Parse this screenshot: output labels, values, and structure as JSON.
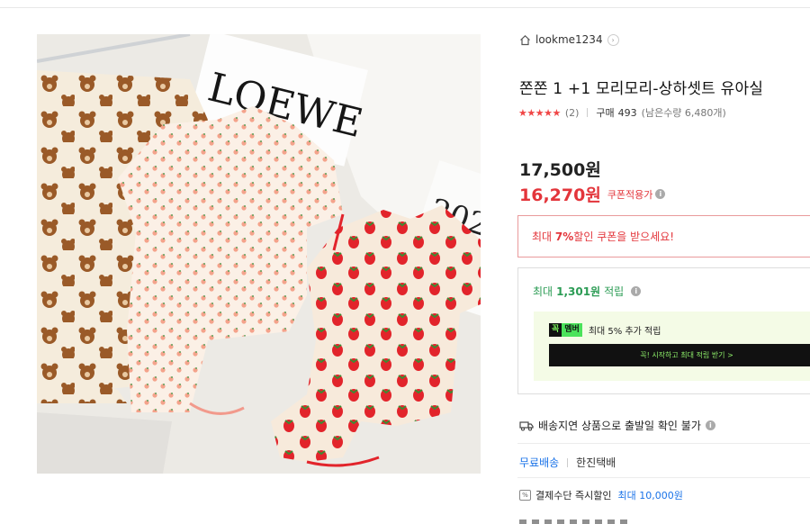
{
  "seller": {
    "name": "lookme1234",
    "home_icon": "home-icon",
    "chevron_icon": "chevron-right-icon"
  },
  "product": {
    "title": "쫀쫀 1 +1 모리모리-상하셋트 유아실",
    "rating_stars": "★★★★★",
    "review_count": "(2)",
    "purchase_label": "구매",
    "purchase_count": "493",
    "stock_text": "(남은수량 6,480개)",
    "price_original": "17,500원",
    "price_sale": "16,270원",
    "coupon_applied_label": "쿠폰적용가"
  },
  "coupon_banner": {
    "prefix": "최대 ",
    "percent": "7%",
    "suffix": " 할인 쿠폰을 받으세요!"
  },
  "points": {
    "prefix": "최대 ",
    "amount": "1,301원",
    "suffix": " 적립",
    "member": {
      "badge_left": "꼭",
      "badge_right": "멤버",
      "text": "최대 5% 추가 적립",
      "button_label": "꼭! 시작하고 최대 적립 받기 >"
    }
  },
  "shipping": {
    "delay_text": "배송지연 상품으로 출발일 확인 불가",
    "free_shipping": "무료배송",
    "courier": "한진택배"
  },
  "payment": {
    "label": "결제수단 즉시할인 ",
    "value": "최대 10,000원"
  },
  "image_text": {
    "brand": "LOEWE",
    "book": "202"
  },
  "colors": {
    "sale_red": "#e3353b",
    "points_green": "#2c9c55",
    "link_blue": "#1a73e8",
    "member_bg": "#f4fbe6"
  }
}
